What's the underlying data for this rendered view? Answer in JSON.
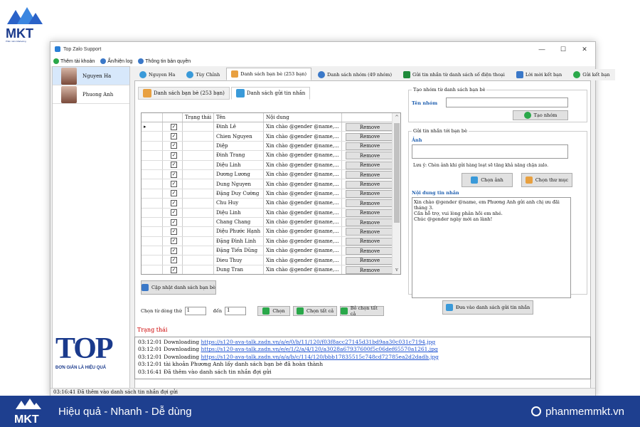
{
  "brand": {
    "logo_text": "MKT",
    "logo_sub": "Phần mềm Marketing",
    "slogan": "Hiệu quả - Nhanh  - Dễ dùng",
    "website": "phanmemmkt.vn"
  },
  "window": {
    "title": "Top Zalo Support",
    "controls": [
      "—",
      "☐",
      "✕"
    ]
  },
  "menu": [
    {
      "label": "Thêm tài khoản",
      "color": "#2aa84a"
    },
    {
      "label": "Ẩn/hiện log",
      "color": "#3a78c8"
    },
    {
      "label": "Thông tin bản quyền",
      "color": "#3a78c8"
    }
  ],
  "accounts": [
    {
      "name": "Nguyen Ha",
      "selected": true
    },
    {
      "name": "Phuong Anh",
      "selected": false
    }
  ],
  "left_brand": {
    "big": "TOP",
    "tag": "ĐƠN GIẢN LÀ HIỆU QUẢ"
  },
  "main_tabs": [
    {
      "label": "Nguyen Ha",
      "color": "#3a9ad9",
      "active": false
    },
    {
      "label": "Tùy Chỉnh",
      "color": "#3a9ad9",
      "active": false
    },
    {
      "label": "Danh sách bạn bè (253 bạn)",
      "color": "#e8a040",
      "active": true
    },
    {
      "label": "Danh sách nhóm (49 nhóm)",
      "color": "#3a78c8",
      "active": false
    },
    {
      "label": "Gửi tin nhắn từ danh sách số điện thoại",
      "color": "#1f8a3a",
      "active": false
    },
    {
      "label": "Lời mời kết bạn",
      "color": "#3a78c8",
      "active": false
    },
    {
      "label": "Gửi kết bạn",
      "color": "#2aa84a",
      "active": false
    }
  ],
  "sub_tabs": [
    {
      "label": "Danh sách bạn bè (253 bạn)",
      "active": false
    },
    {
      "label": "Danh sách gửi tin nhắn",
      "active": true
    }
  ],
  "grid": {
    "headers": [
      "",
      "",
      "Trạng thái",
      "Tên",
      "Nội dung",
      ""
    ],
    "message": "Xin chào @gender @name,...",
    "remove_label": "Remove",
    "rows": [
      "Đinh Lê",
      "Chien Nguyen",
      "Diệp",
      "Đinh Trang",
      "Diệu Linh",
      "Dương Lương",
      "Dung Nguyen",
      "Đặng Duy Cường",
      "Chu Huy",
      "Diệu Linh",
      "Chang Chang",
      "Diệu Phước Hạnh",
      "Đặng Đình Linh",
      "Đặng Tiến Dũng",
      "Dieu Thuy",
      "Dung Tran"
    ]
  },
  "update_button": "Cập nhật danh sách bạn bè",
  "select_range": {
    "from_label": "Chọn từ dòng thứ",
    "from_value": "1",
    "to_label": "đến",
    "to_value": "1",
    "select": "Chọn",
    "select_all": "Chọn tất cả",
    "deselect_all": "Bỏ chọn tất cả"
  },
  "right": {
    "group1_title": "Tạo nhóm từ danh sách bạn bè",
    "group_name_label": "Tên nhóm",
    "create_group": "Tạo nhóm",
    "group2_title": "Gửi tin nhắn tới bạn bè",
    "image_label": "Ảnh",
    "note": "Lưu ý: Chèn ảnh khi gửi hàng loạt sẽ tăng khả năng chặn zalo.",
    "choose_image": "Chọn ảnh",
    "choose_folder": "Chọn thư mục",
    "content_label": "Nội dung tin nhắn",
    "content_lines": [
      "Xin chào @gender @name, em Phương Anh gửi anh chị ưu đãi tháng 3.",
      "Cần hỗ trợ, vui lòng phản hồi em nhé.",
      "Chúc @gender ngày mới an lành!"
    ],
    "send_list": "Đưa vào danh sách gửi tin nhắn"
  },
  "status": {
    "label": "Trạng thái",
    "log": [
      {
        "time": "03:12:01",
        "text": "Downloading ",
        "link": "https://s120-ava-talk.zadn.vn/a/e/0/b/11/120/f03f8acc27145d31bd9aa30c031c7194.jpg"
      },
      {
        "time": "03:12:01",
        "text": "Downloading ",
        "link": "https://s120-ava-talk.zadn.vn/e/e/1/2/a/4/120/a3028a67937600f5c06def65570a1261.jpg"
      },
      {
        "time": "03:12:01",
        "text": "Downloading ",
        "link": "https://s120-ava-talk.zadn.vn/a/a/b/c/114/120/bbb17835515c748cd72785ea2d2dadb.jpg"
      },
      {
        "time": "03:12:01",
        "text": "tài khoản Phương Anh lấy danh sách bạn bè đã hoàn thành",
        "link": ""
      },
      {
        "time": "03:16:41",
        "text": "Đã thêm vào danh sách tin nhắn đợi gửi",
        "link": ""
      }
    ],
    "bar": "03:16:41 Đã thêm vào danh sách tin nhắn đợi gửi"
  }
}
